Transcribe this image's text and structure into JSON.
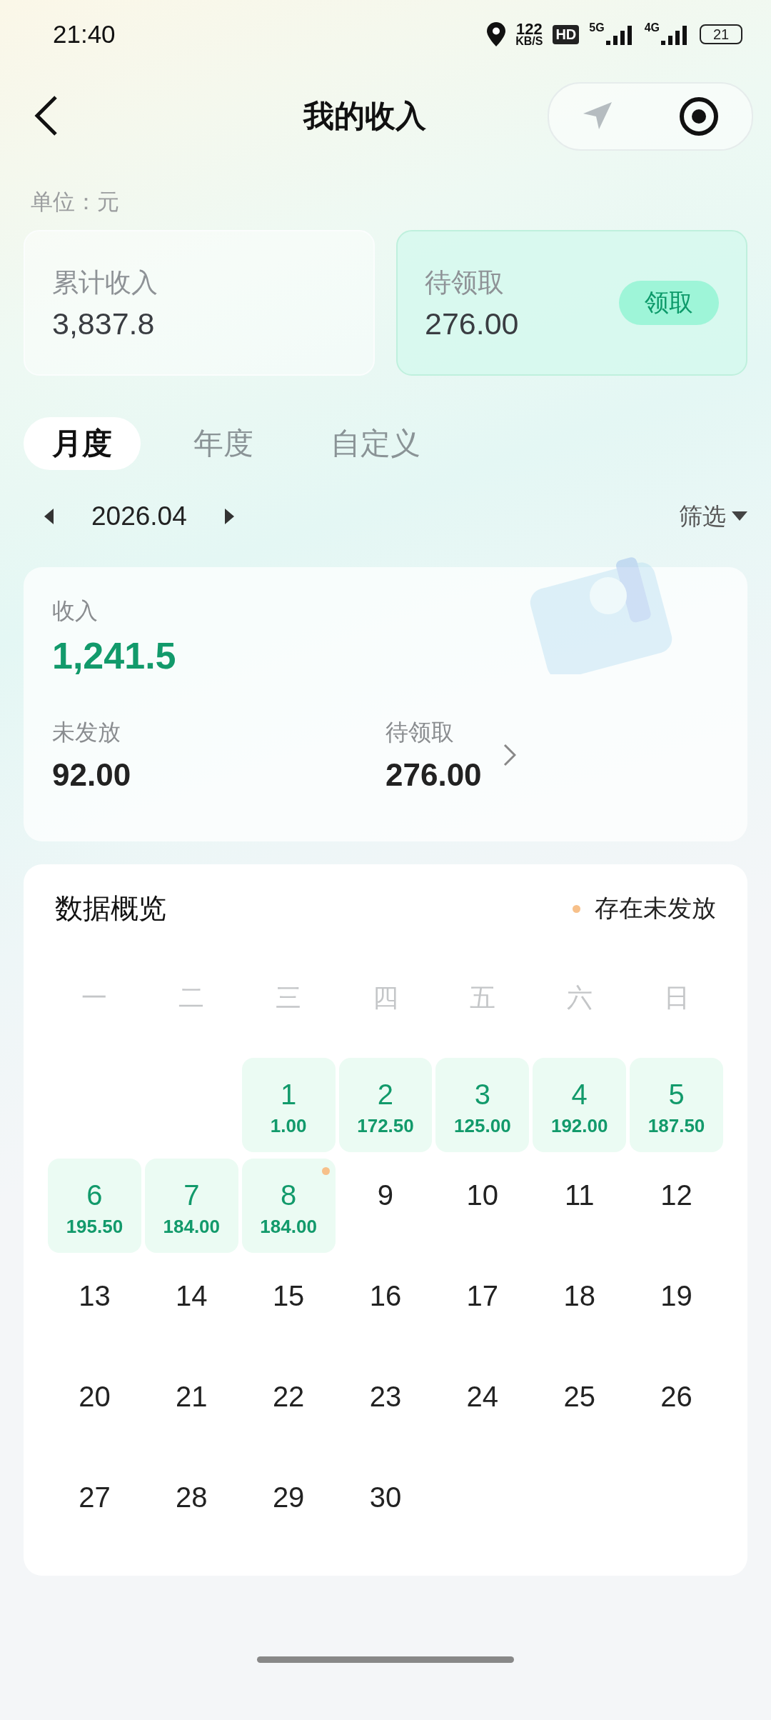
{
  "status_bar": {
    "time": "21:40",
    "speed": "122",
    "speed_unit": "KB/S",
    "hd": "HD",
    "network_1": "5G",
    "network_2": "4G",
    "battery": "21"
  },
  "nav": {
    "title": "我的收入"
  },
  "unit_label": "单位：元",
  "summary_cards": [
    {
      "kind": "plain",
      "label": "累计收入",
      "value": "3,837.8"
    },
    {
      "kind": "claim",
      "label": "待领取",
      "value": "276.00",
      "button": "领取"
    }
  ],
  "tabs": [
    {
      "label": "月度",
      "selected": true
    },
    {
      "label": "年度",
      "selected": false
    },
    {
      "label": "自定义",
      "selected": false
    }
  ],
  "period": {
    "value": "2026.04",
    "filter": "筛选"
  },
  "income_card": {
    "label": "收入",
    "value": "1,241.5",
    "stats": [
      {
        "label": "未发放",
        "value": "92.00",
        "link": false
      },
      {
        "label": "待领取",
        "value": "276.00",
        "link": true
      }
    ]
  },
  "overview": {
    "title": "数据概览",
    "legend": "存在未发放",
    "weekdays": [
      "一",
      "二",
      "三",
      "四",
      "五",
      "六",
      "日"
    ],
    "cells": [
      {
        "kind": "empty"
      },
      {
        "kind": "empty"
      },
      {
        "kind": "income",
        "day": "1",
        "amount": "1.00",
        "unpaid": false
      },
      {
        "kind": "income",
        "day": "2",
        "amount": "172.50",
        "unpaid": false
      },
      {
        "kind": "income",
        "day": "3",
        "amount": "125.00",
        "unpaid": false
      },
      {
        "kind": "income",
        "day": "4",
        "amount": "192.00",
        "unpaid": false
      },
      {
        "kind": "income",
        "day": "5",
        "amount": "187.50",
        "unpaid": false
      },
      {
        "kind": "income",
        "day": "6",
        "amount": "195.50",
        "unpaid": false
      },
      {
        "kind": "income",
        "day": "7",
        "amount": "184.00",
        "unpaid": false
      },
      {
        "kind": "income",
        "day": "8",
        "amount": "184.00",
        "unpaid": true
      },
      {
        "kind": "plain",
        "day": "9",
        "unpaid": false
      },
      {
        "kind": "plain",
        "day": "10",
        "unpaid": false
      },
      {
        "kind": "plain",
        "day": "11",
        "unpaid": false
      },
      {
        "kind": "plain",
        "day": "12",
        "unpaid": false
      },
      {
        "kind": "plain",
        "day": "13",
        "unpaid": false
      },
      {
        "kind": "plain",
        "day": "14",
        "unpaid": false
      },
      {
        "kind": "plain",
        "day": "15",
        "unpaid": false
      },
      {
        "kind": "plain",
        "day": "16",
        "unpaid": false
      },
      {
        "kind": "plain",
        "day": "17",
        "unpaid": false
      },
      {
        "kind": "plain",
        "day": "18",
        "unpaid": false
      },
      {
        "kind": "plain",
        "day": "19",
        "unpaid": false
      },
      {
        "kind": "plain",
        "day": "20",
        "unpaid": false
      },
      {
        "kind": "plain",
        "day": "21",
        "unpaid": false
      },
      {
        "kind": "plain",
        "day": "22",
        "unpaid": false
      },
      {
        "kind": "plain",
        "day": "23",
        "unpaid": false
      },
      {
        "kind": "plain",
        "day": "24",
        "unpaid": false
      },
      {
        "kind": "plain",
        "day": "25",
        "unpaid": false
      },
      {
        "kind": "plain",
        "day": "26",
        "unpaid": false
      },
      {
        "kind": "plain",
        "day": "27",
        "unpaid": false
      },
      {
        "kind": "plain",
        "day": "28",
        "unpaid": false
      },
      {
        "kind": "plain",
        "day": "29",
        "unpaid": false
      },
      {
        "kind": "plain",
        "day": "30",
        "unpaid": false
      }
    ]
  }
}
